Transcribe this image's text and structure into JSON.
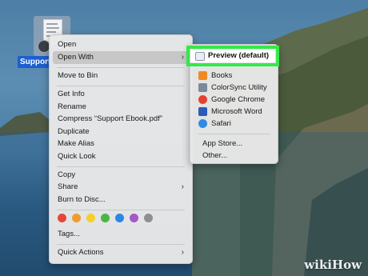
{
  "desktop": {
    "file_label": "Support"
  },
  "context_menu": {
    "group1": [
      {
        "label": "Open",
        "submenu": false
      },
      {
        "label": "Open With",
        "submenu": true,
        "highlighted": true
      }
    ],
    "group2": [
      {
        "label": "Move to Bin"
      }
    ],
    "group3": [
      {
        "label": "Get Info"
      },
      {
        "label": "Rename"
      },
      {
        "label": "Compress “Support Ebook.pdf”"
      },
      {
        "label": "Duplicate"
      },
      {
        "label": "Make Alias"
      },
      {
        "label": "Quick Look"
      }
    ],
    "group4": [
      {
        "label": "Copy",
        "submenu": false
      },
      {
        "label": "Share",
        "submenu": true
      },
      {
        "label": "Burn to Disc...",
        "submenu": false
      }
    ],
    "tag_colors": [
      "#e5463b",
      "#f09a2f",
      "#f4cf2c",
      "#4cb547",
      "#2f86e6",
      "#a557c9",
      "#8e8e93"
    ],
    "tags_label": "Tags...",
    "quick_actions_label": "Quick Actions"
  },
  "open_with_submenu": {
    "default_app": {
      "label": "Preview (default)",
      "icon": "preview-icon"
    },
    "apps": [
      {
        "label": "Books",
        "icon": "books-icon",
        "color": "#f08a24"
      },
      {
        "label": "ColorSync Utility",
        "icon": "colorsync-icon",
        "color": "#7b8a9a"
      },
      {
        "label": "Google Chrome",
        "icon": "chrome-icon",
        "color": "#e34133"
      },
      {
        "label": "Microsoft Word",
        "icon": "word-icon",
        "color": "#2b5cb8"
      },
      {
        "label": "Safari",
        "icon": "safari-icon",
        "color": "#2f8ae8"
      }
    ],
    "app_store_label": "App Store...",
    "other_label": "Other..."
  },
  "highlight_color": "#35e84a",
  "watermark": "wikiHow"
}
